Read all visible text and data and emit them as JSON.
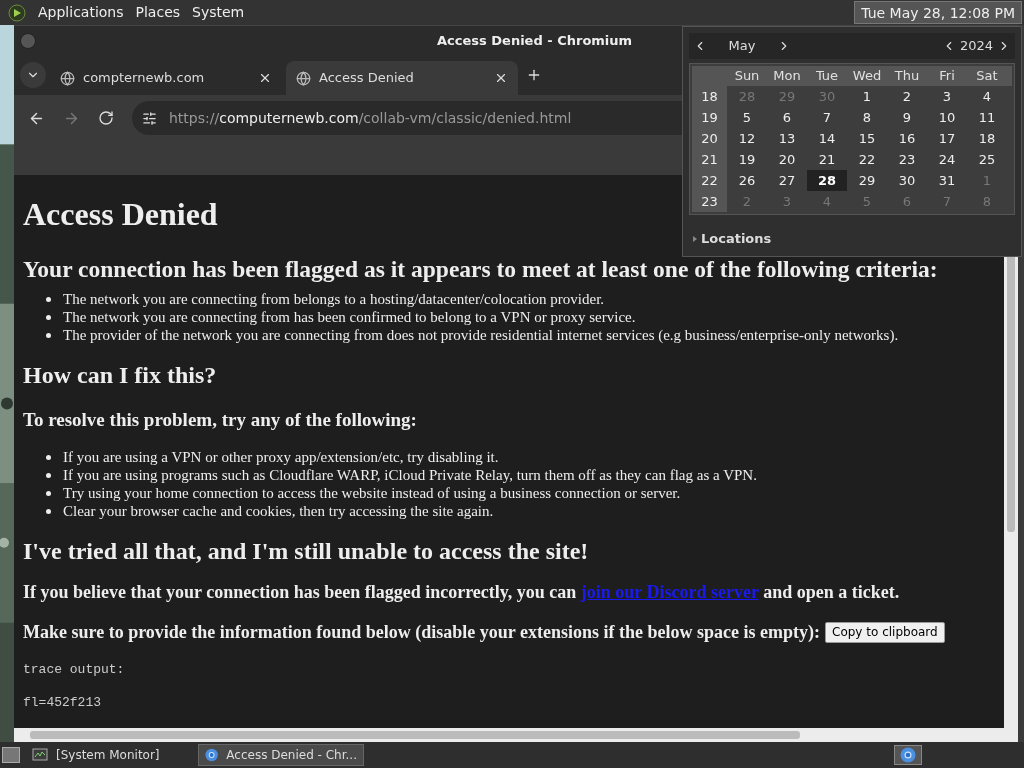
{
  "top_panel": {
    "menus": [
      "Applications",
      "Places",
      "System"
    ],
    "clock": {
      "text": "Tue May 28, 12:08 PM",
      "selected": true
    }
  },
  "window": {
    "title": "Access Denied - Chromium"
  },
  "tabs": [
    {
      "label": "compternewb.com",
      "selected": false
    },
    {
      "label": "Access Denied",
      "selected": true
    }
  ],
  "address_bar": {
    "scheme": "https://",
    "host": "computernewb.com",
    "path": "/collab-vm/classic/denied.html"
  },
  "page": {
    "title": "Access Denied",
    "criteria_heading": "Your connection has been flagged as it appears to meet at least one of the following criteria:",
    "criteria": [
      "The network you are connecting from belongs to a hosting/datacenter/colocation provider.",
      "The network you are connecting from has been confirmed to belong to a VPN or proxy service.",
      "The provider of the network you are connecting from does not provide residential internet services (e.g business/enterprise-only networks)."
    ],
    "fix_heading": "How can I fix this?",
    "resolve_heading": "To resolve this problem, try any of the following:",
    "resolve_items": [
      "If you are using a VPN or other proxy app/extension/etc, try disabling it.",
      "If you are using programs such as Cloudflare WARP, iCloud Private Relay, turn them off as they can flag as a VPN.",
      "Try using your home connection to access the website instead of using a business connection or server.",
      "Clear your browser cache and cookies, then try accessing the site again."
    ],
    "tried_heading": "I've tried all that, and I'm still unable to access the site!",
    "flagged_before": "If you believe that your connection has been flagged incorrectly, you can ",
    "flagged_link": "join our Discord server",
    "flagged_after": " and open a ticket.",
    "make_sure": "Make sure to provide the information found below (disable your extensions if the below space is empty):",
    "copy_button": "Copy to clipboard",
    "trace_label": "trace output:",
    "trace_line": "fl=452f213"
  },
  "calendar": {
    "month": "May",
    "year": "2024",
    "weekdays": [
      "Sun",
      "Mon",
      "Tue",
      "Wed",
      "Thu",
      "Fri",
      "Sat"
    ],
    "weeks": [
      {
        "number": "18",
        "days": [
          {
            "day": "28",
            "muted": true,
            "selected": false
          },
          {
            "day": "29",
            "muted": true,
            "selected": false
          },
          {
            "day": "30",
            "muted": true,
            "selected": false
          },
          {
            "day": "1",
            "muted": false,
            "selected": false
          },
          {
            "day": "2",
            "muted": false,
            "selected": false
          },
          {
            "day": "3",
            "muted": false,
            "selected": false
          },
          {
            "day": "4",
            "muted": false,
            "selected": false
          }
        ]
      },
      {
        "number": "19",
        "days": [
          {
            "day": "5",
            "muted": false,
            "selected": false
          },
          {
            "day": "6",
            "muted": false,
            "selected": false
          },
          {
            "day": "7",
            "muted": false,
            "selected": false
          },
          {
            "day": "8",
            "muted": false,
            "selected": false
          },
          {
            "day": "9",
            "muted": false,
            "selected": false
          },
          {
            "day": "10",
            "muted": false,
            "selected": false
          },
          {
            "day": "11",
            "muted": false,
            "selected": false
          }
        ]
      },
      {
        "number": "20",
        "days": [
          {
            "day": "12",
            "muted": false,
            "selected": false
          },
          {
            "day": "13",
            "muted": false,
            "selected": false
          },
          {
            "day": "14",
            "muted": false,
            "selected": false
          },
          {
            "day": "15",
            "muted": false,
            "selected": false
          },
          {
            "day": "16",
            "muted": false,
            "selected": false
          },
          {
            "day": "17",
            "muted": false,
            "selected": false
          },
          {
            "day": "18",
            "muted": false,
            "selected": false
          }
        ]
      },
      {
        "number": "21",
        "days": [
          {
            "day": "19",
            "muted": false,
            "selected": false
          },
          {
            "day": "20",
            "muted": false,
            "selected": false
          },
          {
            "day": "21",
            "muted": false,
            "selected": false
          },
          {
            "day": "22",
            "muted": false,
            "selected": false
          },
          {
            "day": "23",
            "muted": false,
            "selected": false
          },
          {
            "day": "24",
            "muted": false,
            "selected": false
          },
          {
            "day": "25",
            "muted": false,
            "selected": false
          }
        ]
      },
      {
        "number": "22",
        "days": [
          {
            "day": "26",
            "muted": false,
            "selected": false
          },
          {
            "day": "27",
            "muted": false,
            "selected": false
          },
          {
            "day": "28",
            "muted": false,
            "selected": true
          },
          {
            "day": "29",
            "muted": false,
            "selected": false
          },
          {
            "day": "30",
            "muted": false,
            "selected": false
          },
          {
            "day": "31",
            "muted": false,
            "selected": false
          },
          {
            "day": "1",
            "muted": true,
            "selected": false
          }
        ]
      },
      {
        "number": "23",
        "days": [
          {
            "day": "2",
            "muted": true,
            "selected": false
          },
          {
            "day": "3",
            "muted": true,
            "selected": false
          },
          {
            "day": "4",
            "muted": true,
            "selected": false
          },
          {
            "day": "5",
            "muted": true,
            "selected": false
          },
          {
            "day": "6",
            "muted": true,
            "selected": false
          },
          {
            "day": "7",
            "muted": true,
            "selected": false
          },
          {
            "day": "8",
            "muted": true,
            "selected": false
          }
        ]
      }
    ],
    "locations": "Locations"
  },
  "taskbar": [
    {
      "label": "[System Monitor]",
      "kind": "monitor",
      "selected": false
    },
    {
      "label": "Access Denied - Chr...",
      "kind": "browser",
      "selected": true
    }
  ]
}
